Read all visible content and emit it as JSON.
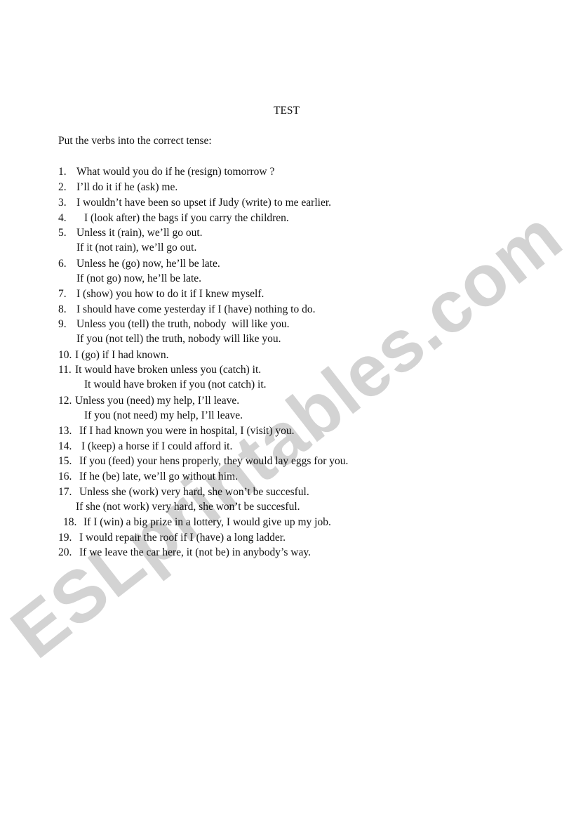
{
  "document": {
    "title": "TEST",
    "instructions": "Put the verbs into the correct tense:",
    "watermark": "ESLprintables.com",
    "items": [
      {
        "num": "1.",
        "text": "What would you do if he (resign) tomorrow ?"
      },
      {
        "num": "2.",
        "text": "I’ll do it if he (ask) me."
      },
      {
        "num": "3.",
        "text": "I wouldn’t have been so upset if Judy (write) to me earlier."
      },
      {
        "num": "4.",
        "text": "I (look after) the bags if you carry the children."
      },
      {
        "num": "5.",
        "text": "Unless it (rain), we’ll go out."
      },
      {
        "num": "",
        "text": "If it (not rain), we’ll go out."
      },
      {
        "num": "6.",
        "text": "Unless he (go) now, he’ll be late."
      },
      {
        "num": "",
        "text": "If (not go) now, he’ll be late."
      },
      {
        "num": "7.",
        "text": "I (show) you how to do it if I knew myself."
      },
      {
        "num": "8.",
        "text": "I should have come yesterday if I (have) nothing to do."
      },
      {
        "num": "9.",
        "text": "Unless you (tell) the truth, nobody  will like you."
      },
      {
        "num": "",
        "text": "If you (not tell) the truth, nobody will like you."
      },
      {
        "num": "10.",
        "text": "I (go) if I had known."
      },
      {
        "num": "11.",
        "text": "It would have broken unless you (catch) it."
      },
      {
        "num": "",
        "text": "It would have broken if you (not catch) it."
      },
      {
        "num": "12.",
        "text": "Unless you (need) my help, I’ll leave."
      },
      {
        "num": "",
        "text": "If you (not need) my help, I’ll leave."
      },
      {
        "num": "13.",
        "text": "If I had known you were in hospital, I (visit) you."
      },
      {
        "num": "14.",
        "text": "I (keep) a horse if I could afford it."
      },
      {
        "num": "15.",
        "text": "If you (feed) your hens properly, they would lay eggs for you."
      },
      {
        "num": "16.",
        "text": "If he (be) late, we’ll go without him."
      },
      {
        "num": "17.",
        "text": "Unless she (work) very hard, she won’t be succesful."
      },
      {
        "num": "",
        "text": "If she (not work) very hard, she won’t be succesful."
      },
      {
        "num": "18.",
        "text": "If I (win) a big prize in a lottery, I would give up my job."
      },
      {
        "num": "19.",
        "text": "I would repair the roof if I (have) a long ladder."
      },
      {
        "num": "20.",
        "text": "If we leave the car here, it (not be) in anybody’s way."
      }
    ]
  }
}
